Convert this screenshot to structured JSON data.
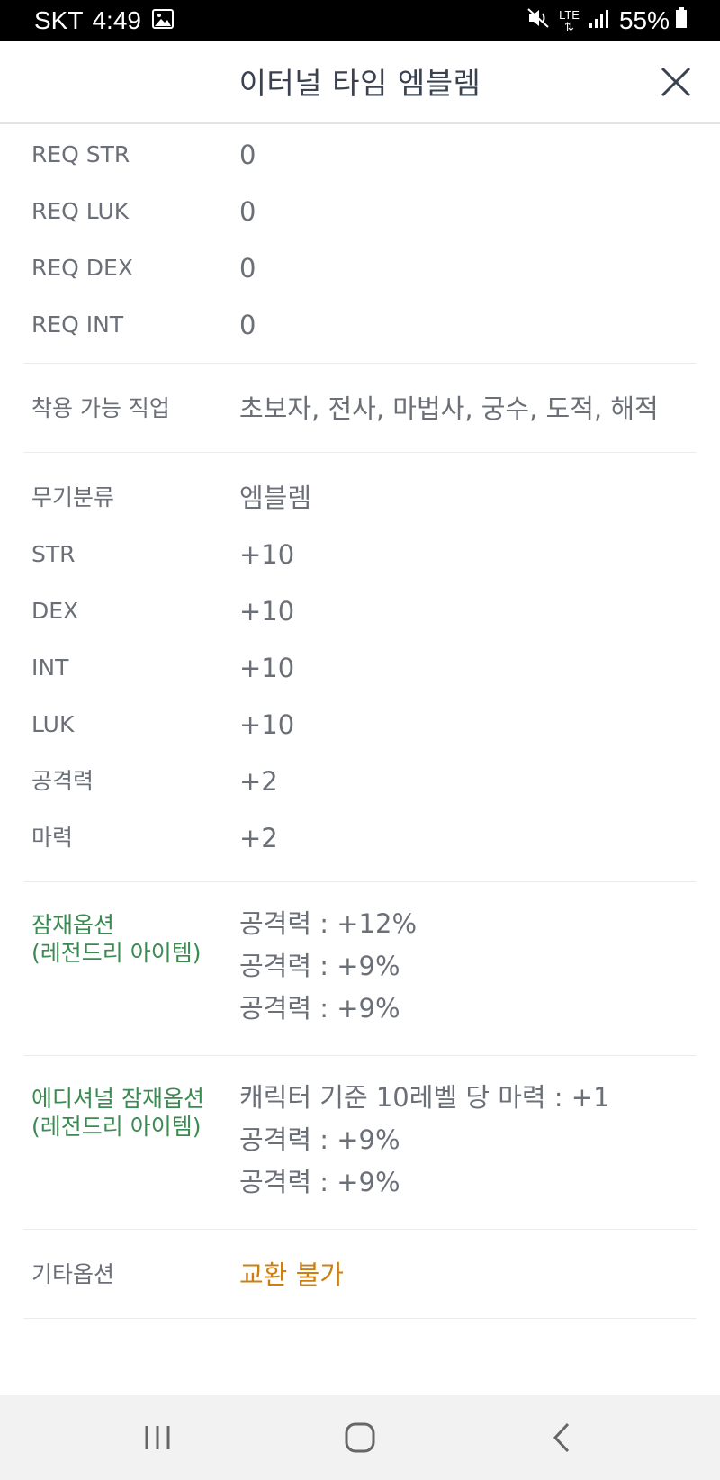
{
  "status_bar": {
    "carrier": "SKT",
    "time": "4:49",
    "network": "LTE",
    "battery": "55%"
  },
  "header": {
    "title": "이터널 타임 엠블렘"
  },
  "requirements": [
    {
      "label": "REQ STR",
      "value": "0"
    },
    {
      "label": "REQ LUK",
      "value": "0"
    },
    {
      "label": "REQ DEX",
      "value": "0"
    },
    {
      "label": "REQ INT",
      "value": "0"
    }
  ],
  "jobs": {
    "label": "착용 가능 직업",
    "value": "초보자, 전사, 마법사, 궁수, 도적, 해적"
  },
  "stats": [
    {
      "label": "무기분류",
      "value": "엠블렘"
    },
    {
      "label": "STR",
      "value": "+10"
    },
    {
      "label": "DEX",
      "value": "+10"
    },
    {
      "label": "INT",
      "value": "+10"
    },
    {
      "label": "LUK",
      "value": "+10"
    },
    {
      "label": "공격력",
      "value": "+2"
    },
    {
      "label": "마력",
      "value": "+2"
    }
  ],
  "potential": {
    "label_line1": "잠재옵션",
    "label_line2": "(레전드리 아이템)",
    "lines": [
      "공격력 : +12%",
      "공격력 : +9%",
      "공격력 : +9%"
    ]
  },
  "additional_potential": {
    "label_line1": "에디셔널 잠재옵션",
    "label_line2": "(레전드리 아이템)",
    "lines": [
      "캐릭터 기준 10레벨 당 마력 : +1",
      "공격력 : +9%",
      "공격력 : +9%"
    ]
  },
  "other": {
    "label": "기타옵션",
    "value": "교환 불가"
  },
  "colors": {
    "accent_green": "#3b8a52",
    "accent_orange": "#cf7f12",
    "text_gray": "#6b7078"
  }
}
